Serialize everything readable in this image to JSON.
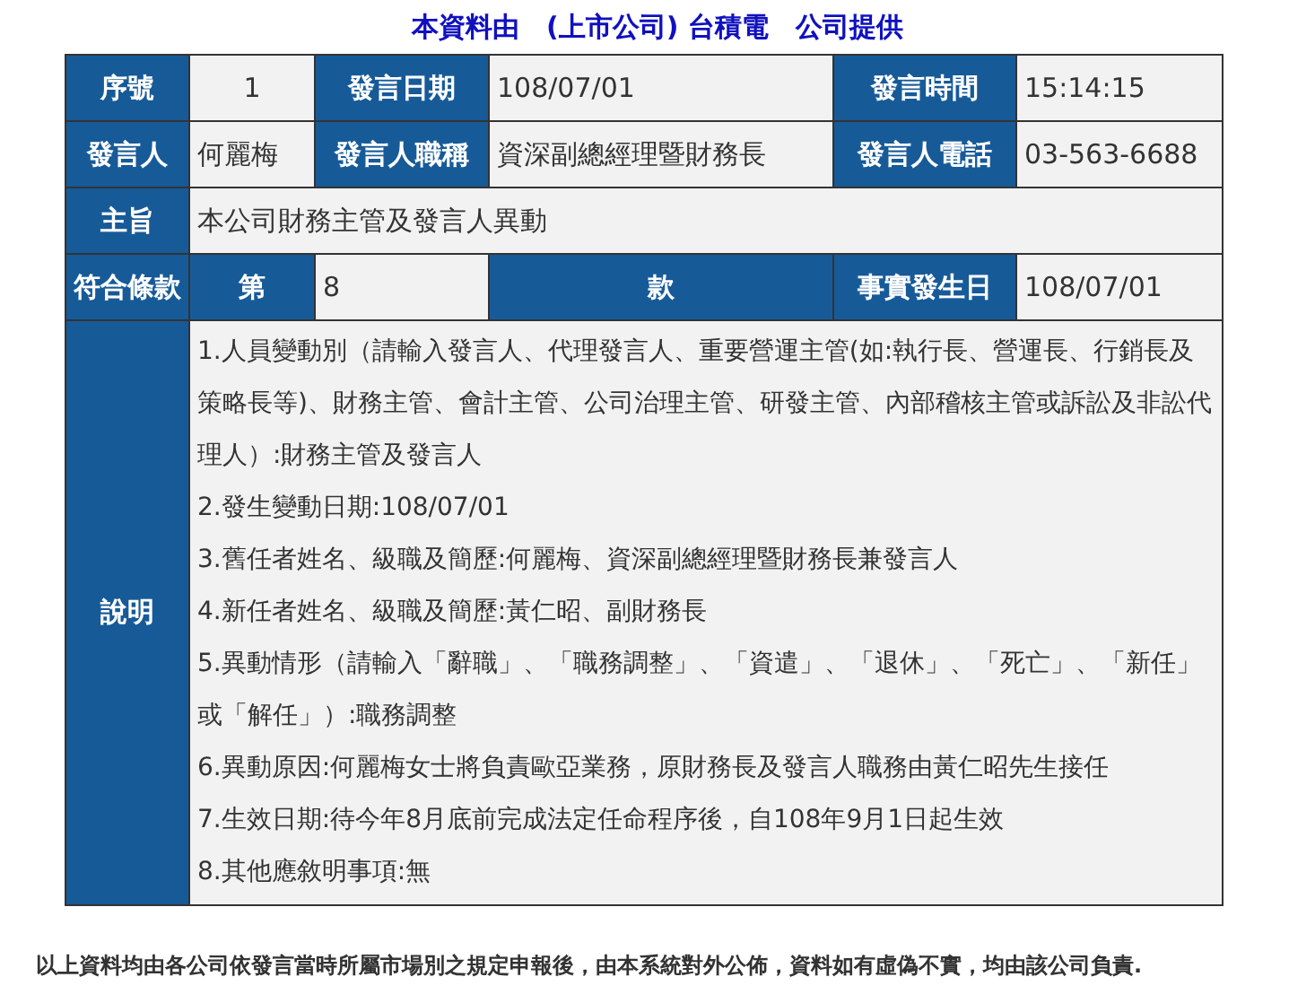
{
  "title": "本資料由　(上市公司) 台積電　公司提供",
  "rows": [
    [
      {
        "kind": "label",
        "text": "序號"
      },
      {
        "kind": "serial",
        "text": "1"
      },
      {
        "kind": "label",
        "text": "發言日期"
      },
      {
        "kind": "value",
        "text": "108/07/01"
      },
      {
        "kind": "label",
        "text": "發言時間"
      },
      {
        "kind": "value",
        "text": "15:14:15"
      }
    ],
    [
      {
        "kind": "label",
        "text": "發言人"
      },
      {
        "kind": "value",
        "text": "何麗梅"
      },
      {
        "kind": "label",
        "text": "發言人職稱"
      },
      {
        "kind": "value",
        "text": "資深副總經理暨財務長"
      },
      {
        "kind": "label",
        "text": "發言人電話"
      },
      {
        "kind": "value",
        "text": "03-563-6688"
      }
    ],
    [
      {
        "kind": "label",
        "text": "主旨"
      },
      {
        "kind": "value",
        "text": "本公司財務主管及發言人異動"
      }
    ],
    [
      {
        "kind": "label",
        "text": "符合條款"
      },
      {
        "kind": "label",
        "text": "第"
      },
      {
        "kind": "value",
        "text": "8"
      },
      {
        "kind": "label",
        "text": "款"
      },
      {
        "kind": "label",
        "text": "事實發生日"
      },
      {
        "kind": "value",
        "text": "108/07/01"
      }
    ]
  ],
  "description": {
    "label": "說明",
    "items": [
      "1.人員變動別（請輸入發言人、代理發言人、重要營運主管(如:執行長、營運長、行銷長及策略長等)、財務主管、會計主管、公司治理主管、研發主管、內部稽核主管或訴訟及非訟代理人）:財務主管及發言人",
      "2.發生變動日期:108/07/01",
      "3.舊任者姓名、級職及簡歷:何麗梅、資深副總經理暨財務長兼發言人",
      "4.新任者姓名、級職及簡歷:黃仁昭、副財務長",
      "5.異動情形（請輸入「辭職」、「職務調整」、「資遣」、「退休」、「死亡」、「新任」或「解任」）:職務調整",
      "6.異動原因:何麗梅女士將負責歐亞業務，原財務長及發言人職務由黃仁昭先生接任",
      "7.生效日期:待今年8月底前完成法定任命程序後，自108年9月1日起生效",
      "8.其他應敘明事項:無"
    ]
  },
  "footer": "以上資料均由各公司依發言當時所屬市場別之規定申報後，由本系統對外公佈，資料如有虛偽不實，均由該公司負責."
}
